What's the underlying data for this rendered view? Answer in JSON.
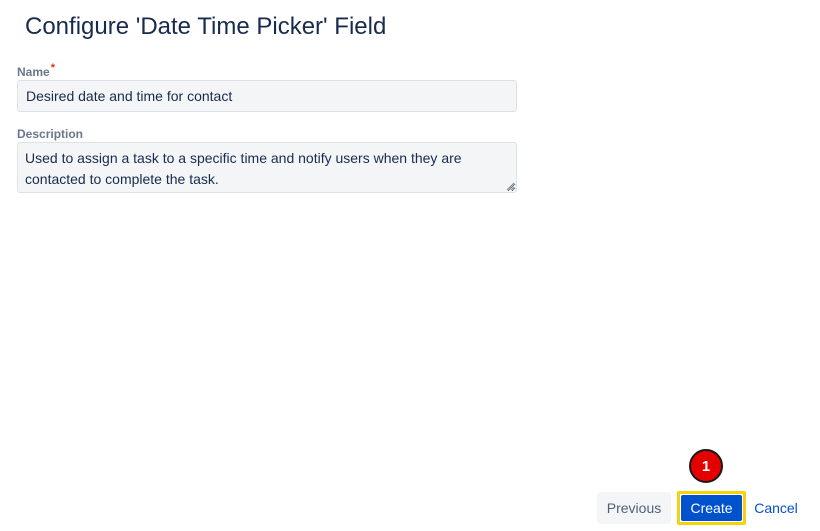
{
  "dialog": {
    "title": "Configure 'Date Time Picker' Field"
  },
  "form": {
    "name": {
      "label": "Name",
      "required_mark": "*",
      "value": "Desired date and time for contact"
    },
    "description": {
      "label": "Description",
      "value": "Used to assign a task to a specific time and notify users when they are contacted to complete the task."
    }
  },
  "annotation": {
    "step_number": "1"
  },
  "footer": {
    "previous_label": "Previous",
    "create_label": "Create",
    "cancel_label": "Cancel"
  },
  "colors": {
    "primary": "#0052cc",
    "highlight": "#f5d30a",
    "badge": "#e50000",
    "required": "#de350b"
  }
}
